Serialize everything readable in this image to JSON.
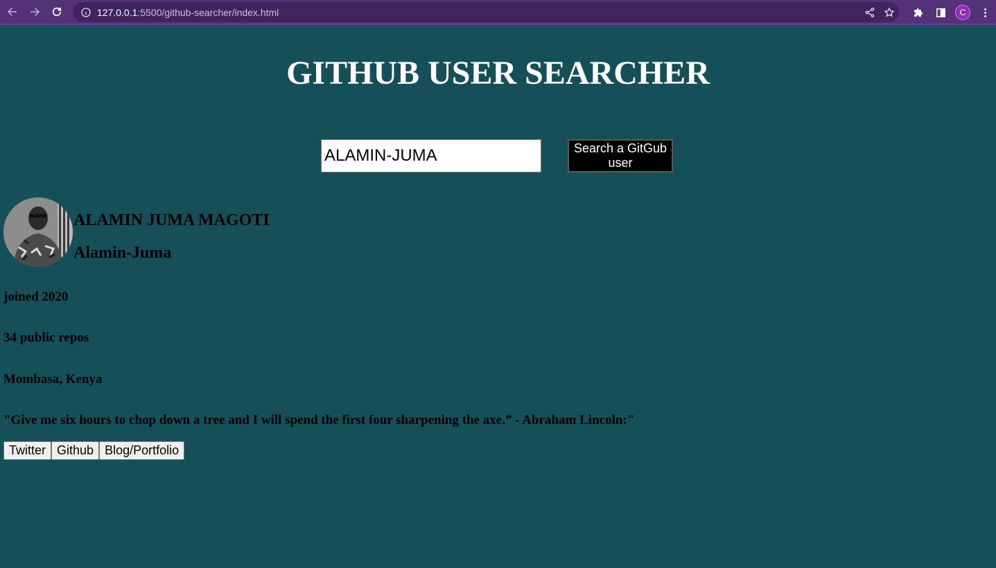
{
  "browser": {
    "url_host": "127.0.0.1",
    "url_path": ":5500/github-searcher/index.html",
    "profile_initial": "C"
  },
  "page": {
    "title": "GITHUB USER SEARCHER",
    "search": {
      "value": "ALAMIN-JUMA",
      "button_label": "Search a GitGub user"
    },
    "profile": {
      "name": "ALAMIN JUMA MAGOTI",
      "login": "Alamin-Juma",
      "joined": "joined 2020",
      "repos": "34 public repos",
      "location": "Mombasa, Kenya",
      "bio": "\"Give me six hours to chop down a tree and I will spend the first four sharpening the axe.” - Abraham Lincoln:\""
    },
    "links": [
      "Twitter",
      "Github",
      "Blog/Portfolio"
    ]
  }
}
